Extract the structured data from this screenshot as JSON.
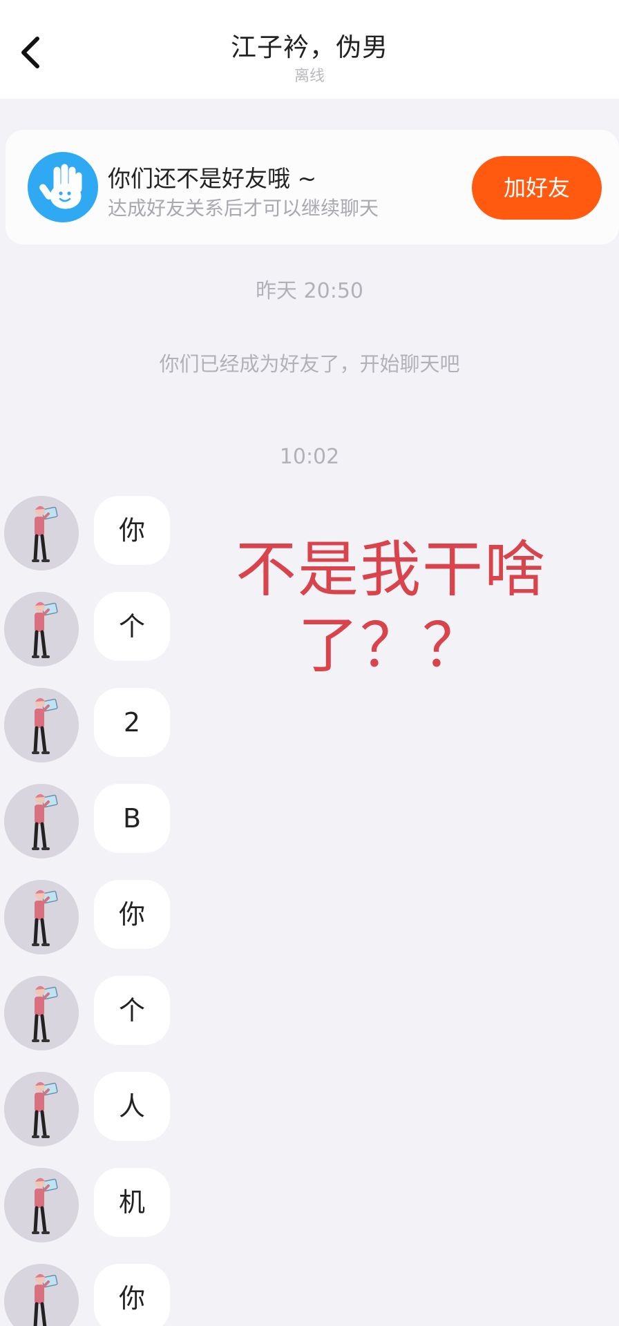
{
  "header": {
    "title": "江子衿，伪男",
    "status": "离线",
    "back_icon": "chevron-left-icon"
  },
  "friend_banner": {
    "title": "你们还不是好友哦 ~",
    "subtitle": "达成好友关系后才可以继续聊天",
    "button_label": "加好友",
    "icon": "hand-wave-icon",
    "accent_color": "#ff5a0f",
    "icon_color": "#2fa9f2"
  },
  "chat": {
    "timestamp_1": "昨天 20:50",
    "system_message": "你们已经成为好友了，开始聊天吧",
    "timestamp_2": "10:02",
    "messages": [
      {
        "text": "你"
      },
      {
        "text": "个"
      },
      {
        "text": "2"
      },
      {
        "text": "B"
      },
      {
        "text": "你"
      },
      {
        "text": "个"
      },
      {
        "text": "人"
      },
      {
        "text": "机"
      },
      {
        "text": "你"
      }
    ]
  },
  "overlay_caption": {
    "line1": "不是我干啥",
    "line2": "了？？",
    "color": "#d9434b"
  }
}
